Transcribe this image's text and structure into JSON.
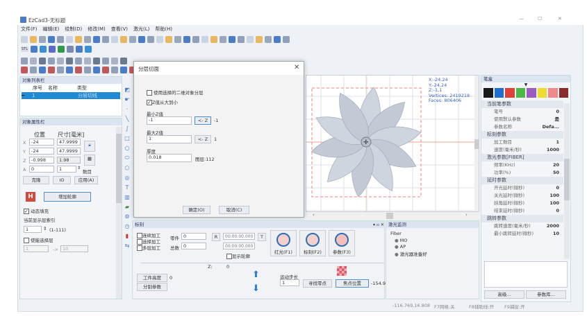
{
  "window": {
    "title": "EzCad3-无标题",
    "controls": [
      "—",
      "☐",
      "✕"
    ]
  },
  "menu": [
    "文件(F)",
    "编辑(E)",
    "绘制(D)",
    "修改(M)",
    "查看(V)",
    "激光(L)",
    "帮助(H)"
  ],
  "toolbar": {
    "stl_label": "STL"
  },
  "object_list": {
    "title": "对象列表栏",
    "columns": [
      "序号",
      "名称",
      "类型"
    ],
    "rows": [
      {
        "index": "1",
        "name": "",
        "type": "分层切线"
      }
    ]
  },
  "properties": {
    "title": "对象属性栏",
    "pos_label": "位置",
    "size_label": "尺寸[毫米]",
    "x_label": "X",
    "y_label": "Y",
    "z_label": "Z",
    "a_label": "A",
    "x": "-24",
    "y": "-24",
    "z": "-0.998",
    "a": "0",
    "w": "47.9999",
    "h": "47.9999",
    "d": "1.98",
    "count": "1",
    "count_label": "数目",
    "clone": "克隆",
    "io": "IO",
    "apply": "应用(A)",
    "add_contour": "增加轮廓",
    "dynamic_fill": "动态填充",
    "layer_index_label": "当前显示层索引",
    "layer_index": "1",
    "layer_range": "(1-111)",
    "enable_layers": "使能选择层",
    "layer_from": "1",
    "layer_arrow": "->",
    "layer_to": "10"
  },
  "dialog": {
    "title": "分层切面",
    "opt1": "使用选择的二维对象分层",
    "opt2": "Z值从大到小",
    "min_label": "最小Z值",
    "min": "-1",
    "min_btn": "<- Z",
    "min_val": "-1",
    "max_label": "最大Z值",
    "max": "1",
    "max_btn": "<- Z",
    "max_val": "1",
    "thick_label": "厚度",
    "thick": "0.018",
    "layers": "图层:112",
    "ok": "确定(O)",
    "cancel": "取消(C)"
  },
  "canvas": {
    "info": [
      "X:-24,24",
      "Y:-24,24",
      "Z:-1,1",
      "Vertices: 2419218",
      "Faces: 806406"
    ]
  },
  "mark": {
    "title": "标刻",
    "cont": "连续加工",
    "sel": "选择加工",
    "multi": "多层加工",
    "part_label": "零件",
    "part": "0",
    "total_label": "总数",
    "total": "0",
    "r": "R",
    "t": "T",
    "time1": "00:00:00.000",
    "time2": "00:00:00.000",
    "show_contour": "显示轮廓",
    "red": "红光(F1)",
    "mark": "标刻(F2)",
    "param": "参数(F3)",
    "z_label": "Z:",
    "z": "0",
    "work_height": "工件高度",
    "work_height_val": "0",
    "split_param": "分割参数",
    "step_label": "运动步长",
    "step": "1",
    "find_zero": "寻找零点",
    "focus": "焦点位置",
    "focus_val": "-154.9"
  },
  "laser": {
    "title": "激光监测",
    "type": "Fiber",
    "items": [
      "MO",
      "AP",
      "激光器准备好"
    ]
  },
  "pen": {
    "title": "笔盒",
    "colors": [
      "#1a1a1a",
      "#1e6fd0",
      "#e0403a",
      "#4cb848",
      "#9a5cc0",
      "#eedd30",
      "#f08a8a",
      "#8a2a2a"
    ],
    "groups": [
      {
        "name": "当前笔参数",
        "rows": [
          [
            "笔号",
            "0"
          ],
          [
            "使用默认参数",
            "是"
          ],
          [
            "参数名称",
            "Defa..."
          ]
        ]
      },
      {
        "name": "标刻参数",
        "rows": [
          [
            "加工数目",
            "1"
          ],
          [
            "速度(毫米/秒)",
            "1000"
          ]
        ]
      },
      {
        "name": "激光参数[FIBER]",
        "rows": [
          [
            "频率(KHz)",
            "20"
          ],
          [
            "功率(%)",
            "50"
          ]
        ]
      },
      {
        "name": "延时参数",
        "rows": [
          [
            "开光延时(微秒)",
            "0"
          ],
          [
            "关光延时(微秒)",
            "100"
          ],
          [
            "拐角延时(微秒)",
            "100"
          ],
          [
            "结束延时(微秒)",
            "0"
          ]
        ]
      },
      {
        "name": "跳转参数",
        "rows": [
          [
            "跳转速度(毫米/秒)",
            "2000"
          ],
          [
            "最小跳转延时(微秒)",
            "10"
          ]
        ]
      }
    ],
    "advanced": "高级...",
    "library": "参数库..."
  },
  "status": {
    "coords": "-116.769,16.808",
    "grid": "F7网格:关",
    "guide": "F8辅助线:开",
    "snap": "F9捕捉:开"
  }
}
